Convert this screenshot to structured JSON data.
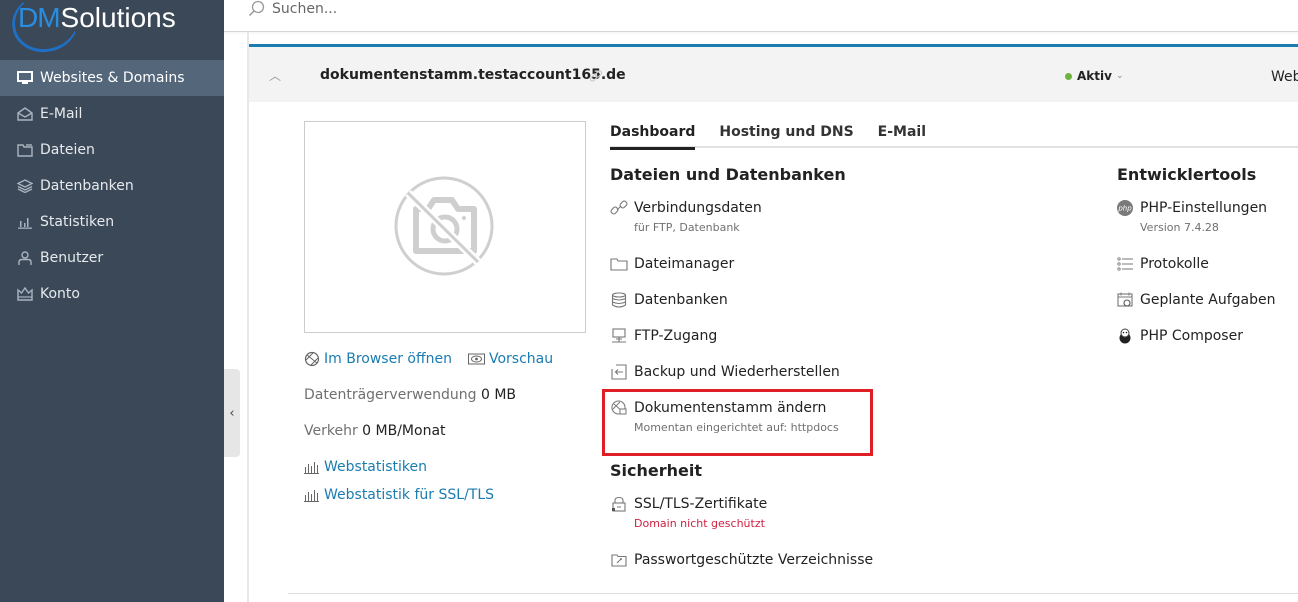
{
  "brand": {
    "logo_dm": "DM",
    "logo_rest": "Solutions"
  },
  "sidebar": {
    "items": [
      {
        "label": "Websites & Domains",
        "icon": "monitor-icon",
        "active": true
      },
      {
        "label": "E-Mail",
        "icon": "mail-icon",
        "active": false
      },
      {
        "label": "Dateien",
        "icon": "folder-icon",
        "active": false
      },
      {
        "label": "Datenbanken",
        "icon": "layers-icon",
        "active": false
      },
      {
        "label": "Statistiken",
        "icon": "bar-chart-icon",
        "active": false
      },
      {
        "label": "Benutzer",
        "icon": "user-icon",
        "active": false
      },
      {
        "label": "Konto",
        "icon": "crown-icon",
        "active": false
      }
    ],
    "collapse_glyph": "‹"
  },
  "search": {
    "placeholder": "Suchen..."
  },
  "domain": {
    "name": "dokumentenstamm.testaccount165.de",
    "status": "Aktiv",
    "status_color": "#6db33f",
    "right_label": "Web",
    "accent_color": "#1a7cb0"
  },
  "preview": {
    "open_browser": "Im Browser öffnen",
    "preview": "Vorschau",
    "disk_label": "Datenträgerverwendung",
    "disk_value": "0 MB",
    "traffic_label": "Verkehr",
    "traffic_value": "0 MB/Monat",
    "webstats": "Webstatistiken",
    "webstats_ssl": "Webstatistik für SSL/TLS"
  },
  "tabs": [
    {
      "label": "Dashboard",
      "active": true
    },
    {
      "label": "Hosting und DNS",
      "active": false
    },
    {
      "label": "E-Mail",
      "active": false
    }
  ],
  "files_section": {
    "title": "Dateien und Datenbanken",
    "items": [
      {
        "label": "Verbindungsdaten",
        "sub": "für FTP, Datenbank",
        "icon": "connection-icon"
      },
      {
        "label": "Dateimanager",
        "icon": "folder-icon"
      },
      {
        "label": "Datenbanken",
        "icon": "database-icon"
      },
      {
        "label": "FTP-Zugang",
        "icon": "ftp-icon"
      },
      {
        "label": "Backup und Wiederherstellen",
        "icon": "backup-icon"
      },
      {
        "label": "Dokumentenstamm ändern",
        "sub": "Momentan eingerichtet auf: httpdocs",
        "icon": "globe-folder-icon"
      }
    ]
  },
  "security_section": {
    "title": "Sicherheit",
    "items": [
      {
        "label": "SSL/TLS-Zertifikate",
        "sub": "Domain nicht geschützt",
        "icon": "lock-icon"
      },
      {
        "label": "Passwortgeschützte Verzeichnisse",
        "icon": "protected-folder-icon"
      }
    ]
  },
  "dev_section": {
    "title": "Entwicklertools",
    "items": [
      {
        "label": "PHP-Einstellungen",
        "sub": "Version 7.4.28",
        "icon": "php-icon"
      },
      {
        "label": "Protokolle",
        "icon": "list-icon"
      },
      {
        "label": "Geplante Aufgaben",
        "icon": "calendar-clock-icon"
      },
      {
        "label": "PHP Composer",
        "icon": "composer-icon"
      }
    ]
  }
}
